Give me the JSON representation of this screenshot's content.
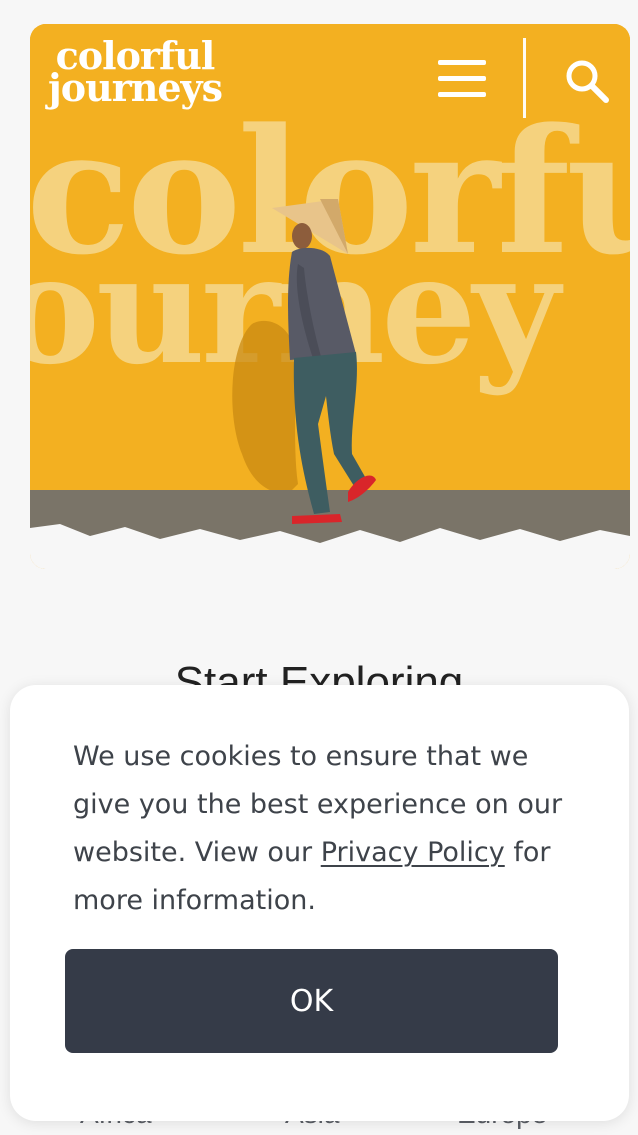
{
  "header": {
    "logo_line1": "colorful",
    "logo_line2": "journeys",
    "menu_icon": "hamburger-menu-icon",
    "search_icon": "search-icon"
  },
  "hero": {
    "background_text_line1": "colorfu",
    "background_text_line2": "ourney",
    "background_color": "#f2ad1d"
  },
  "main": {
    "title": "Start Exploring",
    "regions": [
      "Africa",
      "Asia",
      "Europe"
    ]
  },
  "cookie_banner": {
    "text_before_link": "We use cookies to ensure that we give you the best experience on our website. View our ",
    "link_label": "Privacy Policy",
    "text_after_link": " for more information.",
    "ok_label": "OK",
    "button_color": "#353b48"
  }
}
